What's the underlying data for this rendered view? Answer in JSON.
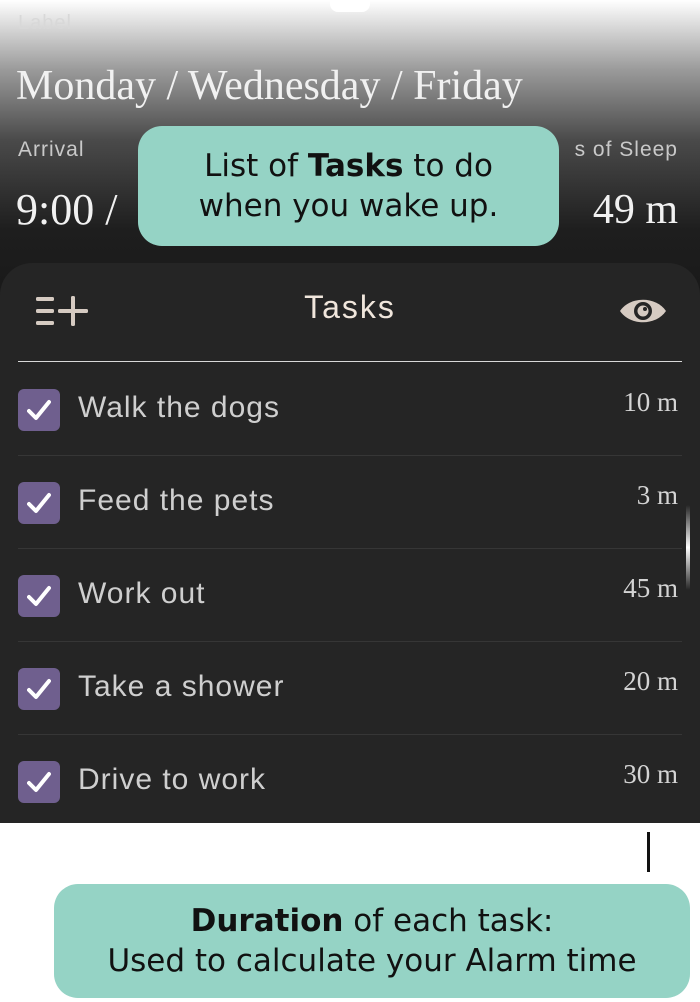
{
  "header": {
    "label": "Label",
    "days": "Monday / Wednesday / Friday",
    "arrival_label": "Arrival",
    "arrival_time": "9:00 /",
    "sleep_label": "s of Sleep",
    "sleep_value": "49 m"
  },
  "callouts": {
    "top_line1_prefix": "List of ",
    "top_line1_bold": "Tasks",
    "top_line1_suffix": " to do",
    "top_line2": "when you wake up.",
    "bottom_line1_bold": "Duration",
    "bottom_line1_suffix": " of each task:",
    "bottom_line2": "Used to calculate your Alarm time"
  },
  "panel": {
    "title": "Tasks",
    "add_icon": "list-add-icon",
    "visibility_icon": "eye-icon"
  },
  "tasks": [
    {
      "name": "Walk the dogs",
      "duration": "10 m",
      "checked": true
    },
    {
      "name": "Feed the pets",
      "duration": "3 m",
      "checked": true
    },
    {
      "name": "Work out",
      "duration": "45 m",
      "checked": true
    },
    {
      "name": "Take a shower",
      "duration": "20 m",
      "checked": true
    },
    {
      "name": "Drive to work",
      "duration": "30 m",
      "checked": true
    }
  ],
  "colors": {
    "callout": "#95d3c5",
    "panel": "#252525",
    "checkbox": "#6f5f8e",
    "title": "#f0e6dc"
  }
}
